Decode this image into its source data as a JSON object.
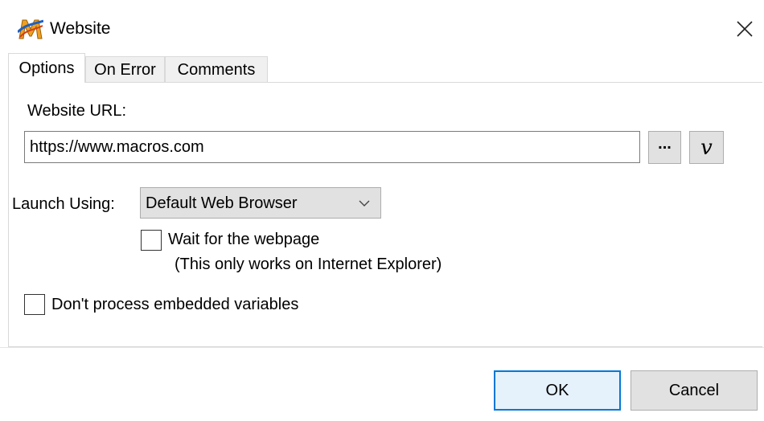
{
  "window": {
    "title": "Website",
    "icon": "macro-express-m-icon",
    "close_icon": "close-icon"
  },
  "tabs": [
    {
      "label": "Options",
      "active": true
    },
    {
      "label": "On Error",
      "active": false
    },
    {
      "label": "Comments",
      "active": false
    }
  ],
  "url": {
    "label": "Website URL:",
    "value": "https://www.macros.com",
    "browse_label": "...",
    "variable_label": "v"
  },
  "launch": {
    "label": "Launch Using:",
    "selected": "Default Web Browser"
  },
  "wait": {
    "label": "Wait for the webpage",
    "note": "(This only works on Internet Explorer)",
    "checked": false
  },
  "embedded": {
    "label": "Don't process embedded variables",
    "checked": false
  },
  "buttons": {
    "ok": "OK",
    "cancel": "Cancel"
  },
  "colors": {
    "accent": "#0078d7",
    "button_face": "#e1e1e1",
    "border": "#adadad"
  }
}
